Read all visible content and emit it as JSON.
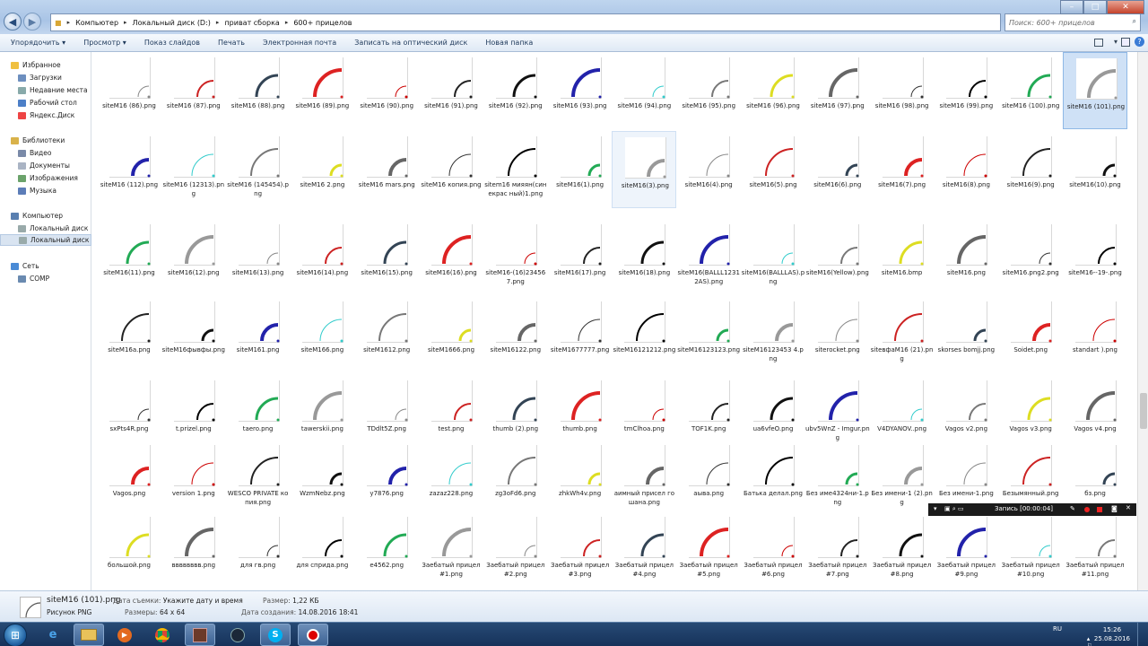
{
  "breadcrumbs": [
    "Компьютер",
    "Локальный диск (D:)",
    "приват сборка",
    "600+ прицелов"
  ],
  "search_placeholder": "Поиск: 600+ прицелов",
  "toolbar": [
    "Упорядочить ▾",
    "Просмотр ▾",
    "Показ слайдов",
    "Печать",
    "Электронная почта",
    "Записать на оптический диск",
    "Новая папка"
  ],
  "nav": {
    "favorites": "Избранное",
    "fav_items": [
      "Загрузки",
      "Недавние места",
      "Рабочий стол",
      "Яндекс.Диск"
    ],
    "libraries": "Библиотеки",
    "lib_items": [
      "Видео",
      "Документы",
      "Изображения",
      "Музыка"
    ],
    "computer": "Компьютер",
    "comp_items": [
      "Локальный диск",
      "Локальный диск"
    ],
    "network": "Сеть",
    "net_items": [
      "COMP"
    ]
  },
  "files": [
    [
      "siteM16 (86).png",
      "siteM16 (87).png",
      "siteM16 (88).png",
      "siteM16 (89).png",
      "siteM16 (90).png",
      "siteM16 (91).png",
      "siteM16 (92).png",
      "siteM16 (93).png",
      "siteM16 (94).png",
      "siteM16 (95).png",
      "siteM16 (96).png",
      "siteM16 (97).png",
      "siteM16 (98).png",
      "siteM16 (99).png",
      "siteM16 (100).png",
      "siteM16 (101).png"
    ],
    [
      "siteM16 (112).png",
      "siteM16 (12313).png",
      "siteM16 (145454).png",
      "siteM16 2.png",
      "siteM16 mars.png",
      "siteM16 копия.png",
      "sitem16 мияян(синекрас ный)1.png",
      "siteM16(1).png",
      "siteM16(3).png",
      "siteM16(4).png",
      "siteM16(5).png",
      "siteM16(6).png",
      "siteM16(7).png",
      "siteM16(8).png",
      "siteM16(9).png",
      "siteM16(10).png"
    ],
    [
      "siteM16(11).png",
      "siteM16(12).png",
      "siteM16(13).png",
      "siteM16(14).png",
      "siteM16(15).png",
      "siteM16(16).png",
      "siteM16-(16)234567.png",
      "siteM16(17).png",
      "siteM16(18).png",
      "siteM16(BALLL12312AS).png",
      "siteM16(BALLLAS).png",
      "siteM16(Yellow).png",
      "siteM16.bmp",
      "siteM16.png",
      "siteM16.png2.png",
      "siteM16--19-.png"
    ],
    [
      "siteM16a.png",
      "siteM16фывфы.png",
      "siteM161.png",
      "siteM166.png",
      "siteM1612.png",
      "siteM1666.png",
      "siteM16122.png",
      "siteM1677777.png",
      "siteM16121212.png",
      "siteM16123123.png",
      "siteM16123453 4.png",
      "siterocket.png",
      "siteвфaM16 (21).png",
      "skorses bomjj.png",
      "Soidet.png",
      "standart ).png"
    ],
    [
      "sxPts4R.png",
      "t.prizel.png",
      "taero.png",
      "tawerskii.png",
      "TDdlt5Z.png",
      "test.png",
      "thumb (2).png",
      "thumb.png",
      "tmClhoa.png",
      "TOF1K.png",
      "ua6vfeO.png",
      "ubv5WnZ - Imgur.png",
      "V4DYANOV..png",
      "Vagos v2.png",
      "Vagos v3.png",
      "Vagos v4.png"
    ],
    [
      "Vagos.png",
      "version 1.png",
      "WESCO PRIVATE копия.png",
      "WzmNebz.png",
      "y7876.png",
      "zazaz228.png",
      "zg3oFd6.png",
      "zhkWh4v.png",
      "аимный присел гошана.png",
      "аыва.png",
      "Батька делал.png",
      "Без име4324ни-1.png",
      "Без имени-1 (2).png",
      "Без имени-1.png",
      "Безымянный.png",
      "бз.png"
    ],
    [
      "большой.png",
      "вввввввв.png",
      "для гв.png",
      "для сприда.png",
      "е4562.png",
      "Заебатый прицел #1.png",
      "Заебатый прицел #2.png",
      "Заебатый прицел #3.png",
      "Заебатый прицел #4.png",
      "Заебатый прицел #5.png",
      "Заебатый прицел #6.png",
      "Заебатый прицел #7.png",
      "Заебатый прицел #8.png",
      "Заебатый прицел #9.png",
      "Заебатый прицел #10.png",
      "Заебатый прицел #11.png"
    ]
  ],
  "details": {
    "filename": "siteM16 (101).png",
    "filetype": "Рисунок PNG",
    "date_taken_label": "Дата съемки:",
    "date_taken": "Укажите дату и время",
    "dimensions_label": "Размеры:",
    "dimensions": "64 x 64",
    "size_label": "Размер:",
    "size": "1,22 КБ",
    "created_label": "Дата создания:",
    "created": "14.08.2016 18:41"
  },
  "recording": "Запись [00:00:04]",
  "tray": {
    "lang": "RU",
    "time": "15:26",
    "date": "25.08.2016"
  }
}
